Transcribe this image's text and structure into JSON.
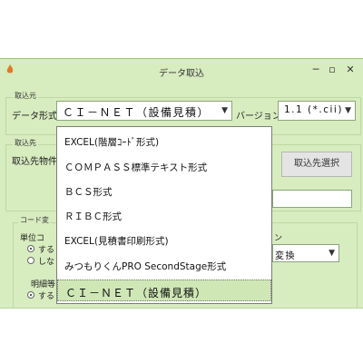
{
  "window": {
    "title": "データ取込",
    "min_glyph": "─",
    "max_glyph": "▫",
    "close_glyph": "✕"
  },
  "colors": {
    "window_bg": "#d7ecbf",
    "selected_bg": "#cfe7b5",
    "icon": "#e07a28"
  },
  "import_source": {
    "group_label": "取込元",
    "format_label": "データ形式",
    "format_value": "ＣＩ－ＮＥＴ（設備見積）",
    "version_label": "バージョン",
    "version_value": "1.1 (*.cii)"
  },
  "import_dest": {
    "group_label": "取込先",
    "property_label": "取込先物件",
    "select_button": "取込先選択"
  },
  "code_conversion": {
    "group_label": "コード変",
    "unit_label": "単位コ",
    "unit_options": [
      "する",
      "しな"
    ],
    "partial_tail": "ン",
    "convert_value": "変換",
    "detail_label": "明細等",
    "detail_option": "する"
  },
  "dropdown": {
    "options": [
      "EXCEL(階層ｺｰﾄﾞ形式)",
      "ＣＯＭＰＡＳＳ標準テキスト形式",
      "ＢＣＳ形式",
      "ＲＩＢＣ形式",
      "EXCEL(見積書印刷形式)",
      "みつもりくんPRO SecondStage形式",
      "ＣＩ－ＮＥＴ（設備見積）"
    ],
    "selected_index": 6
  }
}
